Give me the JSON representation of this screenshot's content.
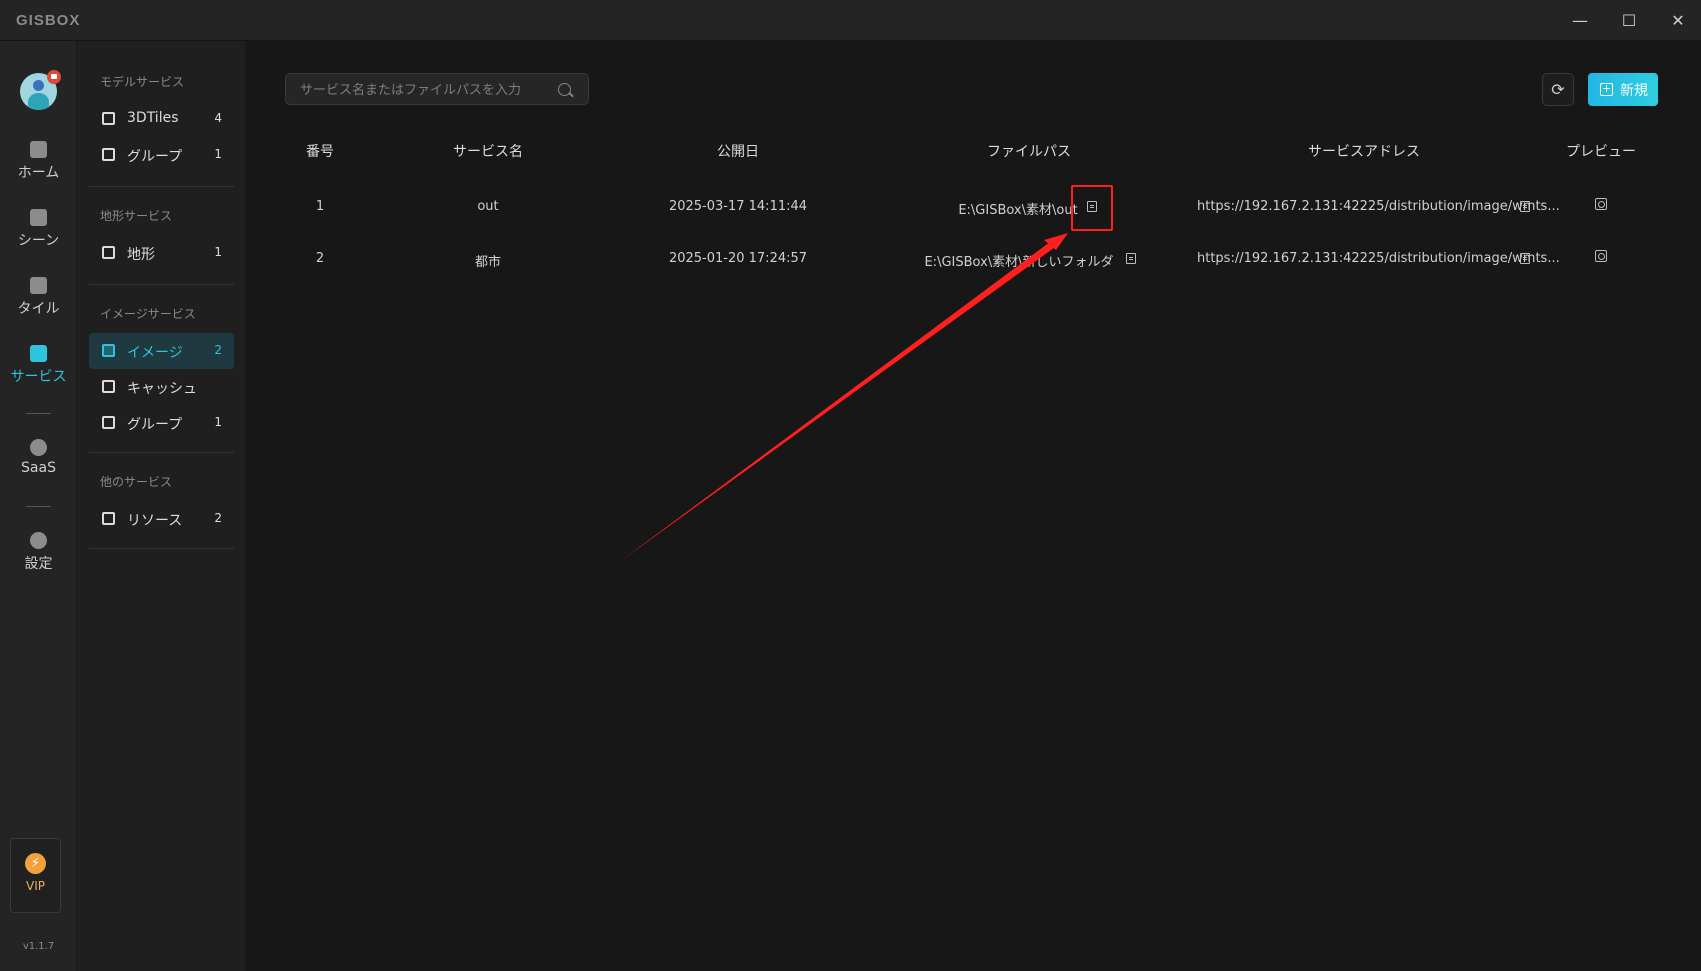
{
  "app": {
    "logo_text": "GISBOX",
    "version": "v1.1.7"
  },
  "window_controls": {
    "minimize": "—",
    "maximize": "☐",
    "close": "✕"
  },
  "rail": {
    "items": [
      {
        "label": "ホーム",
        "icon": "home-icon"
      },
      {
        "label": "シーン",
        "icon": "scene-icon"
      },
      {
        "label": "タイル",
        "icon": "tile-icon"
      },
      {
        "label": "サービス",
        "icon": "service-icon",
        "active": true
      },
      {
        "label": "SaaS",
        "icon": "saas-icon"
      },
      {
        "label": "設定",
        "icon": "settings-icon"
      }
    ],
    "vip_label": "VIP"
  },
  "sidebar": {
    "groups": [
      {
        "title": "モデルサービス",
        "items": [
          {
            "label": "3DTiles",
            "count": "4"
          },
          {
            "label": "グループ",
            "count": "1"
          }
        ]
      },
      {
        "title": "地形サービス",
        "items": [
          {
            "label": "地形",
            "count": "1"
          }
        ]
      },
      {
        "title": "イメージサービス",
        "items": [
          {
            "label": "イメージ",
            "count": "2",
            "active": true
          },
          {
            "label": "キャッシュ",
            "count": ""
          },
          {
            "label": "グループ",
            "count": "1"
          }
        ]
      },
      {
        "title": "他のサービス",
        "items": [
          {
            "label": "リソース",
            "count": "2"
          }
        ]
      }
    ]
  },
  "toolbar": {
    "search_placeholder": "サービス名またはファイルパスを入力",
    "new_label": "新規",
    "refresh_icon": "⟳"
  },
  "table": {
    "headers": {
      "index": "番号",
      "name": "サービス名",
      "date": "公開日",
      "path": "ファイルパス",
      "address": "サービスアドレス",
      "preview": "プレビュー"
    },
    "rows": [
      {
        "index": "1",
        "name": "out",
        "date": "2025-03-17 14:11:44",
        "path": "E:\\GISBox\\素材\\out",
        "address": "https://192.167.2.131:42225/distribution/image/wmts..."
      },
      {
        "index": "2",
        "name": "都市",
        "date": "2025-01-20 17:24:57",
        "path": "E:\\GISBox\\素材\\新しいフォルダ",
        "address": "https://192.167.2.131:42225/distribution/image/wmts..."
      }
    ]
  },
  "annotation": {
    "color": "#ff1f1f"
  }
}
